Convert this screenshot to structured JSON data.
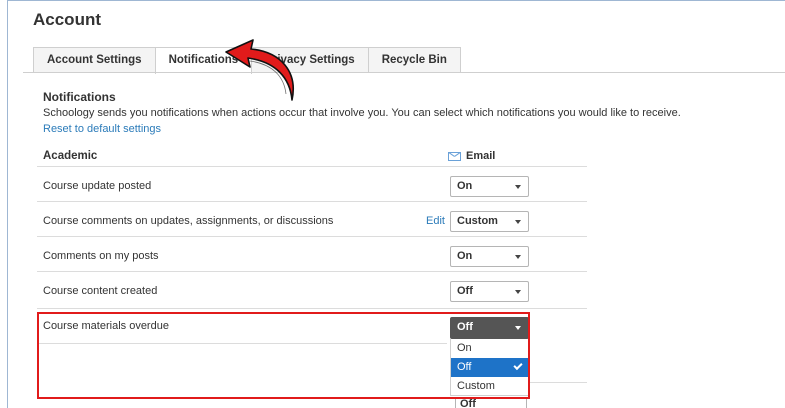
{
  "page": {
    "title": "Account"
  },
  "tabs": [
    {
      "label": "Account Settings",
      "active": false
    },
    {
      "label": "Notifications",
      "active": true
    },
    {
      "label": "Privacy Settings",
      "active": false
    },
    {
      "label": "Recycle Bin",
      "active": false
    }
  ],
  "notifications": {
    "title": "Notifications",
    "description": "Schoology sends you notifications when actions occur that involve you. You can select which notifications you would like to receive.",
    "reset_link": "Reset to default settings"
  },
  "table": {
    "section_label": "Academic",
    "email_header": "Email",
    "email_icon": "mail-icon",
    "rows": [
      {
        "label": "Course update posted",
        "value": "On",
        "edit": ""
      },
      {
        "label": "Course comments on updates, assignments, or discussions",
        "value": "Custom",
        "edit": "Edit"
      },
      {
        "label": "Comments on my posts",
        "value": "On",
        "edit": ""
      },
      {
        "label": "Course content created",
        "value": "Off",
        "edit": ""
      },
      {
        "label": "Course materials overdue",
        "value": "Off",
        "edit": ""
      }
    ],
    "next_row_value": "Off"
  },
  "dropdown": {
    "options": [
      "On",
      "Off",
      "Custom"
    ],
    "selected": "Off"
  },
  "colors": {
    "annotation_red": "#e11b1b",
    "link_blue": "#2b7bb9",
    "selected_option": "#1e73c8",
    "open_select": "#555555"
  }
}
